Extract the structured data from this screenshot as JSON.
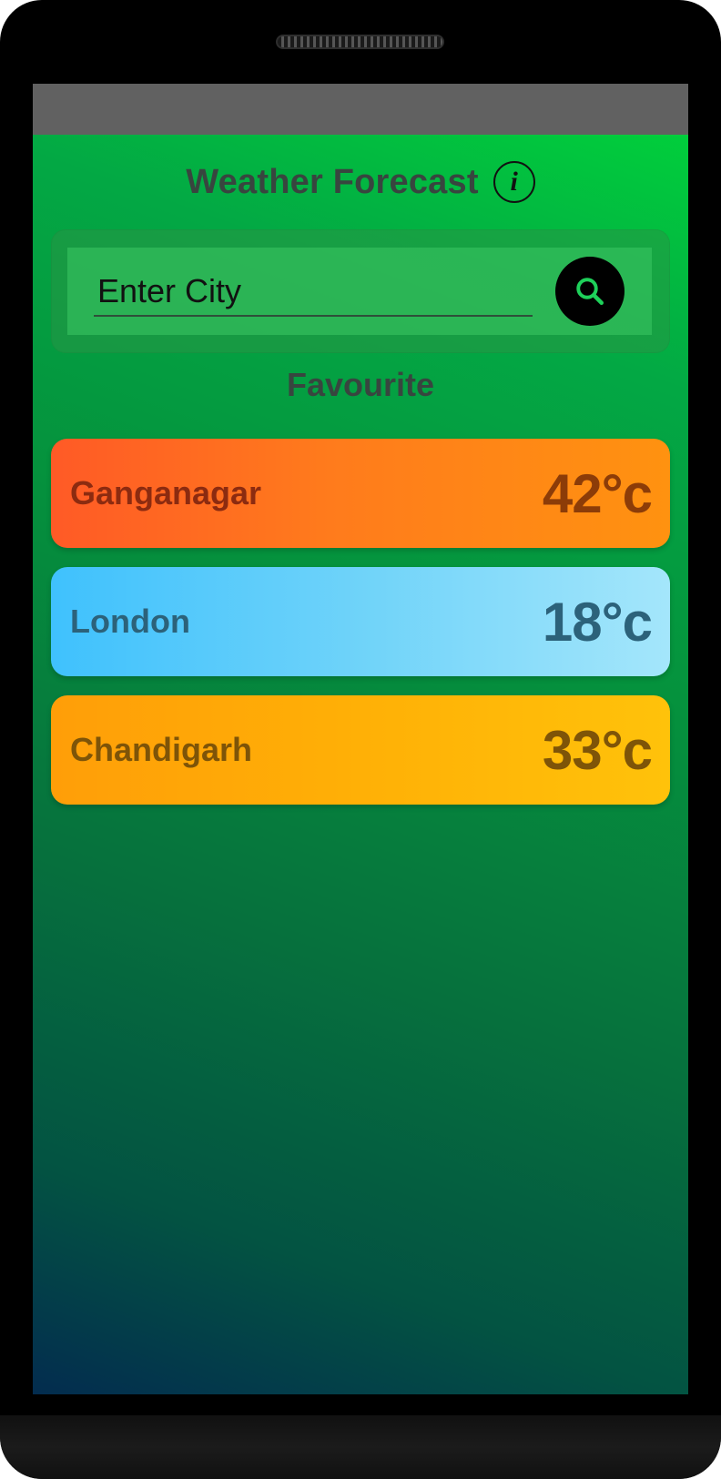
{
  "app": {
    "title": "Weather Forecast"
  },
  "search": {
    "placeholder": "Enter City",
    "value": ""
  },
  "favourites": {
    "title": "Favourite",
    "items": [
      {
        "city": "Ganganagar",
        "temp": "42°c",
        "color": "#ff6a20"
      },
      {
        "city": "London",
        "temp": "18°c",
        "color": "#6fd3f9"
      },
      {
        "city": "Chandigarh",
        "temp": "33°c",
        "color": "#ffb006"
      }
    ]
  },
  "icons": {
    "info": "info-icon",
    "search": "search-icon"
  },
  "colors": {
    "accent_green": "#00d63a",
    "status_bar": "#616161",
    "title_text": "#38453f"
  }
}
